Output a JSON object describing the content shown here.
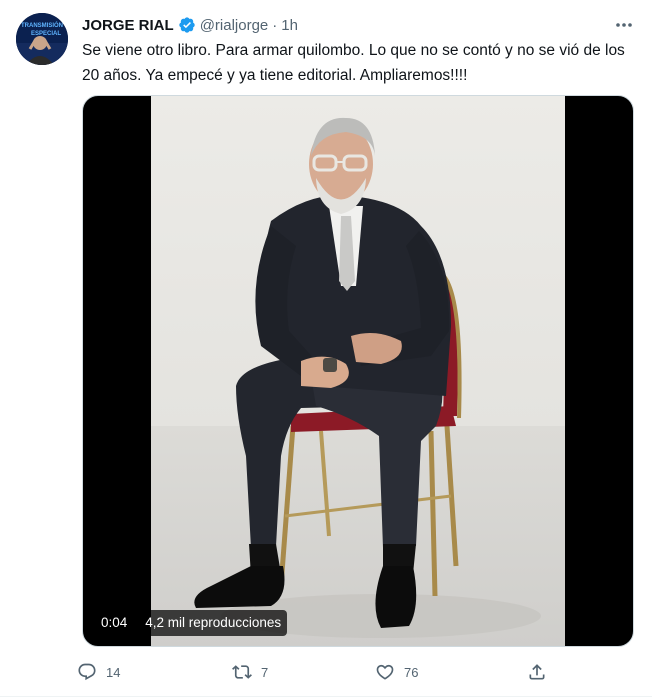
{
  "author": {
    "display_name": "JORGE RIAL",
    "handle": "@rialjorge",
    "separator": "·",
    "time": "1h",
    "avatar_text_1": "TRANSMISIÓN",
    "avatar_text_2": "ESPECIAL"
  },
  "tweet": {
    "text": "Se viene otro libro. Para armar quilombo. Lo que no se contó y no se vió de los 20 años. Ya empecé y ya tiene editorial. Ampliaremos!!!!"
  },
  "media": {
    "video_time": "0:04",
    "views": "4,2 mil reproducciones"
  },
  "actions": {
    "replies": "14",
    "retweets": "7",
    "likes": "76"
  },
  "icons": {
    "verified": "verified-badge-icon",
    "more": "more-icon",
    "reply": "reply-icon",
    "retweet": "retweet-icon",
    "like": "heart-icon",
    "share": "share-icon"
  },
  "colors": {
    "verified": "#1d9bf0",
    "secondary_text": "#536471",
    "primary_text": "#0f1419"
  }
}
